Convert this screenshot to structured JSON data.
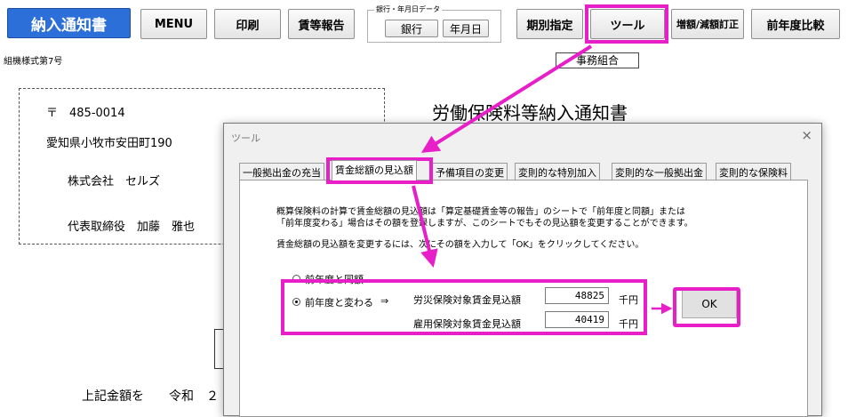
{
  "toolbar": {
    "title": "納入通知書",
    "menu": "MENU",
    "print": "印刷",
    "wage_report": "賃等報告",
    "group_caption": "銀行・年月日データ",
    "bank": "銀行",
    "date": "年月日",
    "period": "期別指定",
    "tool": "ツール",
    "correction": "増額/減額訂正",
    "prev_year": "前年度比較"
  },
  "document": {
    "form_label": "組機様式第7号",
    "office_label": "事務組合",
    "heading": "労働保険料等納入通知書",
    "postal": "〒　485-0014",
    "address": "愛知県小牧市安田町190",
    "company": "株式会社　セルズ",
    "representative": "代表取締役　加藤　雅也",
    "footer_text": "上記金額を　　令和　２"
  },
  "dialog": {
    "title": "ツール",
    "close": "×",
    "tabs": [
      "一般拠出金の充当",
      "賃金総額の見込額",
      "予備項目の変更",
      "変則的な特別加入",
      "変則的な一般拠出金",
      "変則的な保険料"
    ],
    "active_tab": "賃金総額の見込額",
    "instructions": [
      "概算保険料の計算で賃金総額の見込額は「算定基礎賃金等の報告」のシートで「前年度と同額」または",
      "「前年度変わる」場合はその額を登録しますが、このシートでもその見込額を変更することができます。",
      "賃金総額の見込額を変更するには、次にその額を入力して「OK」をクリックしてください。"
    ],
    "radio_same": "前年度と同額",
    "radio_changed": "前年度と変わる",
    "arrow": "⇒",
    "selected": "前年度と変わる",
    "workers_comp_label": "労災保険対象賃金見込額",
    "workers_comp_value": "48825",
    "employment_label": "雇用保険対象賃金見込額",
    "employment_value": "40419",
    "unit": "千円",
    "ok": "OK"
  },
  "colors": {
    "highlight": "#e81ec8",
    "title_button": "#2d6fd8"
  }
}
